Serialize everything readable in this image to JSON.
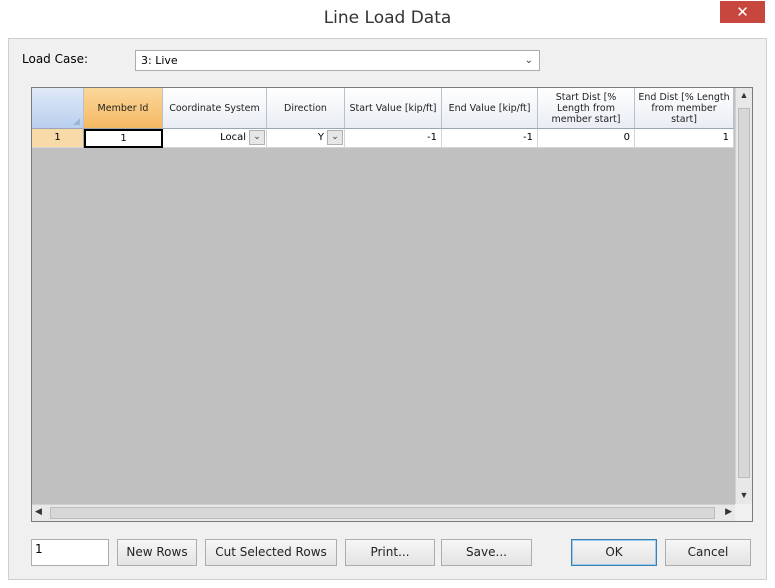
{
  "window": {
    "title": "Line Load Data",
    "close_glyph": "✕"
  },
  "load_case": {
    "label": "Load Case:",
    "value": "3: Live"
  },
  "grid": {
    "columns": [
      "Member Id",
      "Coordinate System",
      "Direction",
      "Start Value [kip/ft]",
      "End Value [kip/ft]",
      "Start Dist [% Length from member start]",
      "End Dist [% Length from member start]"
    ],
    "rows": [
      {
        "row_number": "1",
        "member_id": "1",
        "coordinate_system": "Local",
        "direction": "Y",
        "start_value": "-1",
        "end_value": "-1",
        "start_dist": "0",
        "end_dist": "1"
      }
    ]
  },
  "footer": {
    "rows_count": "1",
    "new_rows": "New Rows",
    "cut_selected_rows": "Cut Selected Rows",
    "print": "Print...",
    "save": "Save...",
    "ok": "OK",
    "cancel": "Cancel"
  },
  "colors": {
    "close_button": "#c7463d",
    "grid_background": "#c0c0c0",
    "selected_header": "#f5b963"
  }
}
